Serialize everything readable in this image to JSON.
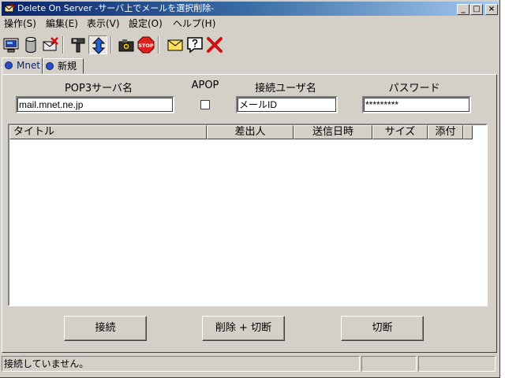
{
  "window": {
    "title": "Delete On Server  -サーバ上でメールを選択削除-",
    "controls": {
      "minimize": "_",
      "maximize": "□",
      "close": "×"
    }
  },
  "menubar": {
    "items": [
      {
        "label": "操作(S)"
      },
      {
        "label": "編集(E)"
      },
      {
        "label": "表示(V)"
      },
      {
        "label": "設定(O)"
      },
      {
        "label": "ヘルプ(H)"
      }
    ]
  },
  "toolbar": {
    "icons": [
      "monitor-icon",
      "database-icon",
      "delete-mail-icon",
      "tools-icon",
      "sync-icon",
      "camera-icon",
      "stop-icon",
      "envelope-icon",
      "help-icon",
      "close-x-icon"
    ],
    "stop_text": "STOP"
  },
  "tabs": [
    {
      "label": "Mnet",
      "active": true
    },
    {
      "label": "新規",
      "active": false
    }
  ],
  "form": {
    "server_label": "POP3サーバ名",
    "server_value": "mail.mnet.ne.jp",
    "apop_label": "APOP",
    "apop_checked": false,
    "user_label": "接続ユーザ名",
    "user_value": "メールID",
    "password_label": "パスワード",
    "password_value": "*********"
  },
  "list": {
    "columns": [
      "タイトル",
      "差出人",
      "送信日時",
      "サイズ",
      "添付"
    ],
    "rows": []
  },
  "buttons": {
    "connect": "接続",
    "delete_disconnect": "削除 + 切断",
    "disconnect": "切断"
  },
  "status": {
    "message": "接続していません。",
    "pane2": "",
    "pane3": ""
  },
  "colors": {
    "face": "#d4d0c8",
    "titlebar": "#0a246a",
    "stop": "#e02020",
    "delete_x": "#d01010"
  }
}
